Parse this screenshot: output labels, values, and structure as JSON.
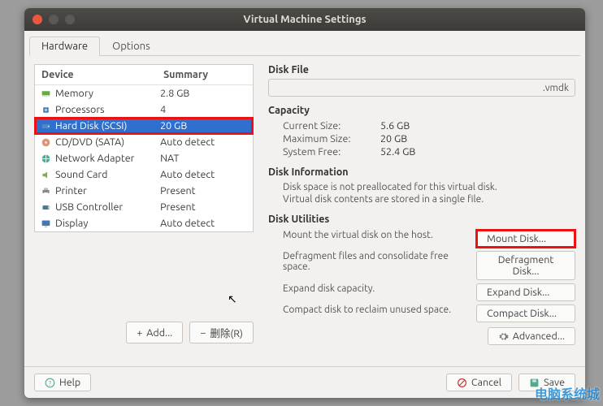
{
  "title": "Virtual Machine Settings",
  "tabs": {
    "hardware": "Hardware",
    "options": "Options"
  },
  "device_header": {
    "device": "Device",
    "summary": "Summary"
  },
  "devices": [
    {
      "name": "Memory",
      "summary": "2.8 GB",
      "icon": "memory"
    },
    {
      "name": "Processors",
      "summary": "4",
      "icon": "cpu"
    },
    {
      "name": "Hard Disk (SCSI)",
      "summary": "20 GB",
      "icon": "hdd",
      "selected": true
    },
    {
      "name": "CD/DVD (SATA)",
      "summary": "Auto detect",
      "icon": "cd"
    },
    {
      "name": "Network Adapter",
      "summary": "NAT",
      "icon": "net"
    },
    {
      "name": "Sound Card",
      "summary": "Auto detect",
      "icon": "sound"
    },
    {
      "name": "Printer",
      "summary": "Present",
      "icon": "printer"
    },
    {
      "name": "USB Controller",
      "summary": "Present",
      "icon": "usb"
    },
    {
      "name": "Display",
      "summary": "Auto detect",
      "icon": "display"
    }
  ],
  "buttons": {
    "add": "Add...",
    "remove": "删除(R)",
    "help": "Help",
    "cancel": "Cancel",
    "save": "Save",
    "advanced": "Advanced...",
    "mount": "Mount Disk...",
    "defrag": "Defragment Disk...",
    "expand": "Expand Disk...",
    "compact": "Compact Disk..."
  },
  "right": {
    "diskfile_label": "Disk File",
    "diskfile_value": ".vmdk",
    "capacity_label": "Capacity",
    "current_size_l": "Current Size:",
    "current_size_v": "5.6 GB",
    "max_size_l": "Maximum Size:",
    "max_size_v": "20 GB",
    "sys_free_l": "System Free:",
    "sys_free_v": "52.4 GB",
    "diskinfo_label": "Disk Information",
    "info1": "Disk space is not preallocated for this virtual disk.",
    "info2": "Virtual disk contents are stored in a single file.",
    "utilities_label": "Disk Utilities",
    "util_mount": "Mount the virtual disk on the host.",
    "util_defrag": "Defragment files and consolidate free space.",
    "util_expand": "Expand disk capacity.",
    "util_compact": "Compact disk to reclaim unused space."
  },
  "watermark": "电脑系统城"
}
